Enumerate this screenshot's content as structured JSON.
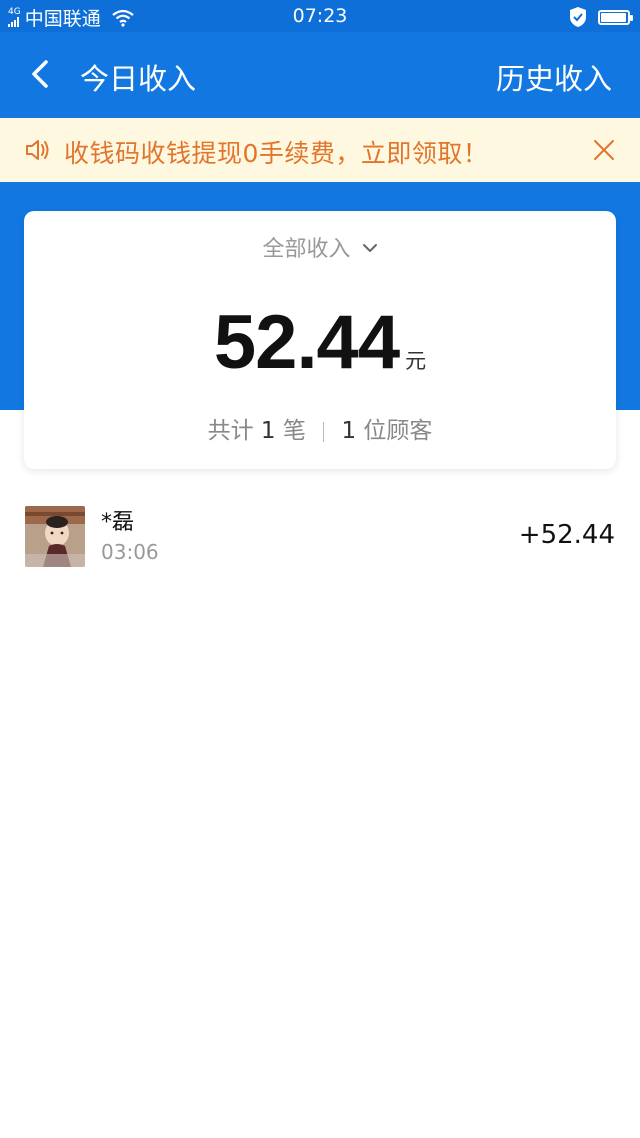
{
  "status_bar": {
    "network": "4G",
    "carrier": "中国联通",
    "time": "07:23",
    "battery_level": 0.95
  },
  "nav": {
    "title": "今日收入",
    "history": "历史收入"
  },
  "notice": {
    "text": "收钱码收钱提现0手续费，立即领取！"
  },
  "summary": {
    "filter": "全部收入",
    "amount": "52.44",
    "unit": "元",
    "meta_prefix": "共计",
    "count": "1",
    "count_unit": "笔",
    "customers": "1",
    "customers_unit": "位顾客"
  },
  "records": [
    {
      "name": "*磊",
      "time": "03:06",
      "amount": "+52.44"
    }
  ],
  "colors": {
    "primary": "#1277e1",
    "status_bar": "#0f6fd8",
    "notice_bg": "#fff8e1",
    "notice_text": "#e2752b"
  }
}
